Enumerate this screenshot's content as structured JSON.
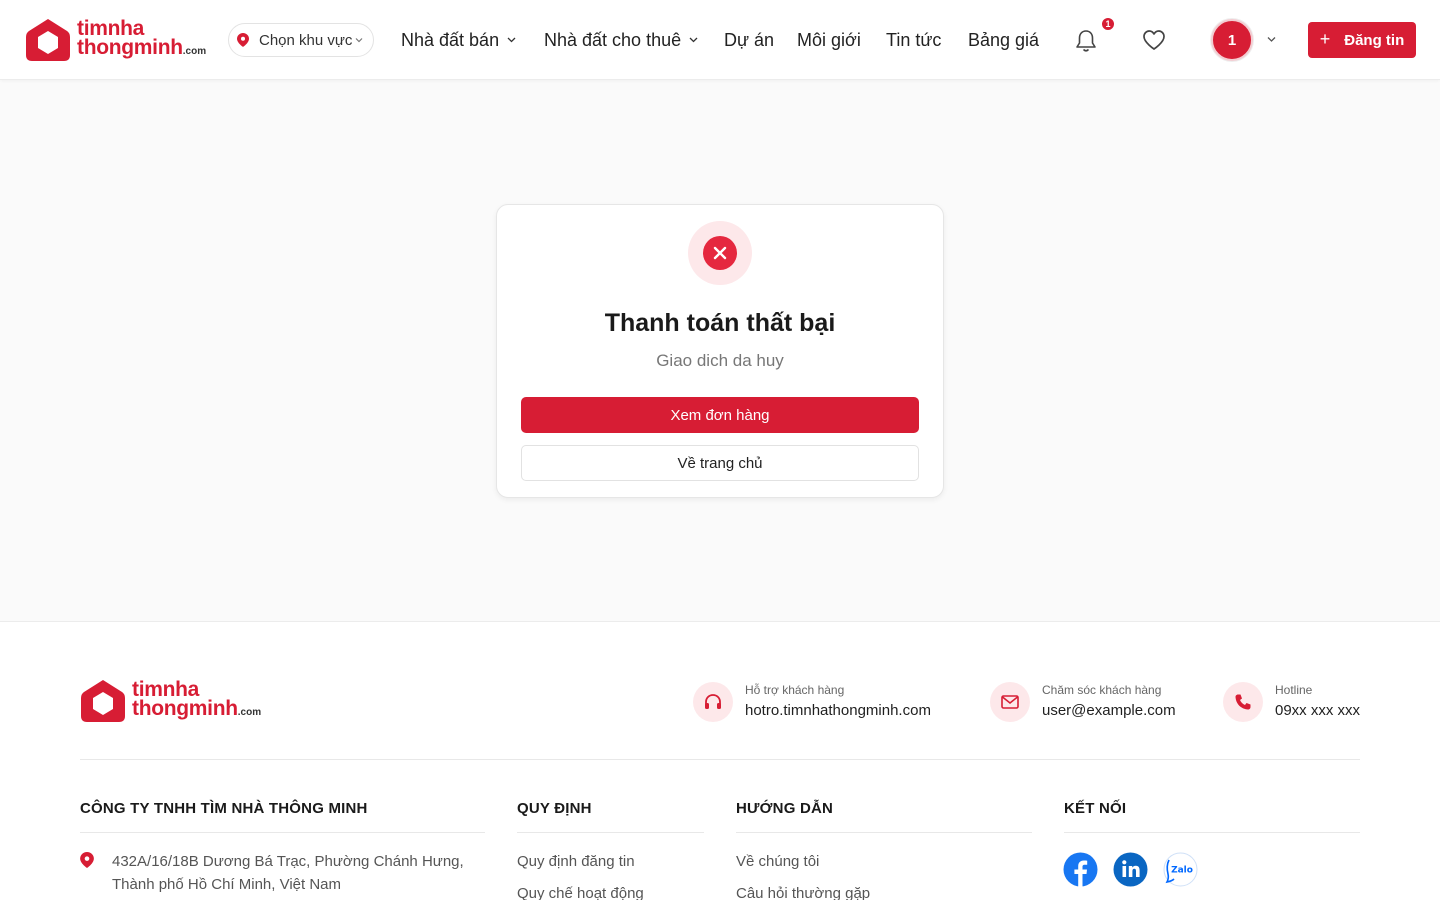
{
  "brand": {
    "line1": "timnha",
    "line2": "thongminh",
    "suffix": ".com"
  },
  "header": {
    "region_label": "Chọn khu vực",
    "nav": [
      {
        "label": "Nhà đất bán",
        "has_dropdown": true
      },
      {
        "label": "Nhà đất cho thuê",
        "has_dropdown": true
      },
      {
        "label": "Dự án",
        "has_dropdown": false
      },
      {
        "label": "Môi giới",
        "has_dropdown": false
      },
      {
        "label": "Tin tức",
        "has_dropdown": false
      },
      {
        "label": "Bảng giá",
        "has_dropdown": false
      }
    ],
    "notification_count": "1",
    "avatar_text": "1",
    "post_button": "Đăng tin"
  },
  "result": {
    "status_icon": "x-circle-icon",
    "title": "Thanh toán thất bại",
    "subtitle": "Giao dich da huy",
    "primary_button": "Xem đơn hàng",
    "secondary_button": "Về trang chủ"
  },
  "footer": {
    "contacts": [
      {
        "icon": "headset-icon",
        "label": "Hỗ trợ khách hàng",
        "value": "hotro.timnhathongminh.com"
      },
      {
        "icon": "mail-icon",
        "label": "Chăm sóc khách hàng",
        "value": "user@example.com"
      },
      {
        "icon": "phone-icon",
        "label": "Hotline",
        "value": "09xx xxx xxx"
      }
    ],
    "company": {
      "title": "CÔNG TY TNHH TÌM NHÀ THÔNG MINH",
      "address": "432A/16/18B Dương Bá Trạc, Phường Chánh Hưng, Thành phố Hồ Chí Minh, Việt Nam"
    },
    "rules": {
      "title": "QUY ĐỊNH",
      "links": [
        "Quy định đăng tin",
        "Quy chế hoạt động"
      ]
    },
    "guides": {
      "title": "HƯỚNG DẪN",
      "links": [
        "Về chúng tôi",
        "Câu hỏi thường gặp"
      ]
    },
    "connect": {
      "title": "KẾT NỐI",
      "networks": [
        "facebook-icon",
        "linkedin-icon",
        "zalo-icon"
      ],
      "zalo_text": "Zalo"
    }
  },
  "colors": {
    "brand_red": "#d71d34",
    "error_red": "#e5283f",
    "soft_pink": "#fde8ea"
  }
}
